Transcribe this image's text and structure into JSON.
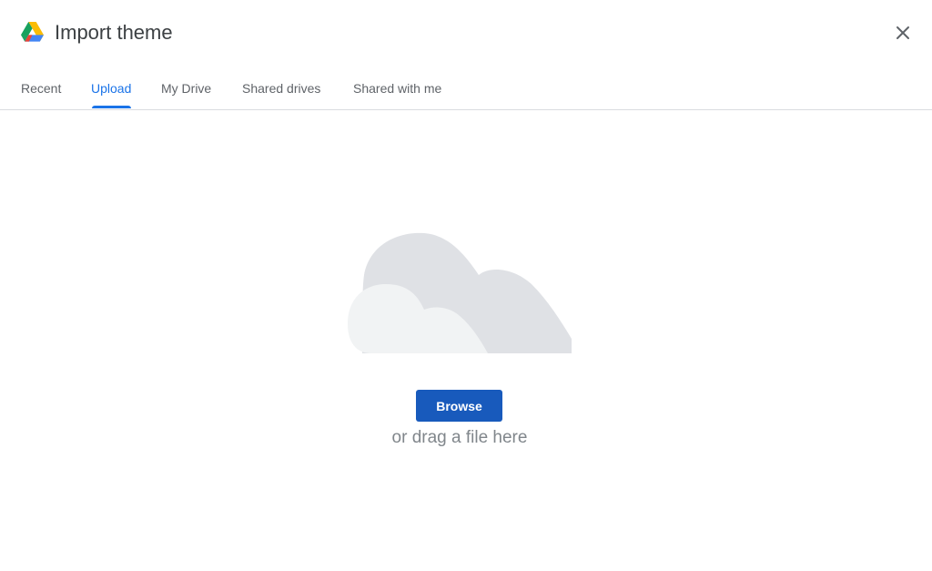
{
  "dialog": {
    "title": "Import theme",
    "logo_icon": "google-drive-icon",
    "close_icon": "close-icon"
  },
  "tabs": [
    {
      "label": "Recent",
      "active": false
    },
    {
      "label": "Upload",
      "active": true
    },
    {
      "label": "My Drive",
      "active": false
    },
    {
      "label": "Shared drives",
      "active": false
    },
    {
      "label": "Shared with me",
      "active": false
    }
  ],
  "upload": {
    "illustration_icon": "cloud-icon",
    "browse_label": "Browse",
    "drag_text": "or drag a file here"
  },
  "colors": {
    "accent": "#1a73e8",
    "button": "#185abc",
    "muted_text": "#80868b",
    "divider": "#dadce0"
  }
}
